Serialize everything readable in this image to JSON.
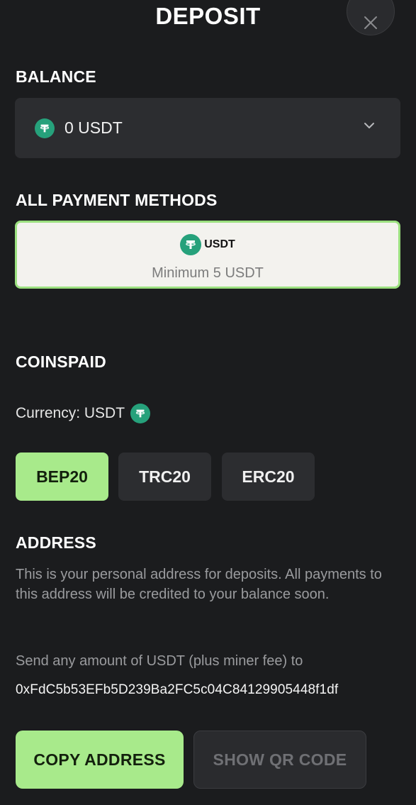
{
  "header": {
    "title": "DEPOSIT",
    "close_icon": "close-icon"
  },
  "balance": {
    "heading": "BALANCE",
    "selected_value": "0 USDT",
    "currency_icon": "tether-icon"
  },
  "payment_methods": {
    "heading": "ALL PAYMENT METHODS",
    "items": [
      {
        "name": "USDT",
        "minimum": "Minimum 5 USDT",
        "selected": true
      }
    ]
  },
  "provider": {
    "heading": "COINSPAID",
    "currency_label": "Currency: USDT",
    "networks": [
      {
        "label": "BEP20",
        "active": true
      },
      {
        "label": "TRC20",
        "active": false
      },
      {
        "label": "ERC20",
        "active": false
      }
    ]
  },
  "address_section": {
    "heading": "ADDRESS",
    "description": "This is your personal address for deposits. All payments to this address will be credited to your balance soon.",
    "send_instruction": "Send any amount of USDT (plus miner fee) to",
    "address": "0xFdC5b53EFb5D239Ba2FC5c04C84129905448f1df"
  },
  "actions": {
    "copy_label": "COPY ADDRESS",
    "qr_label": "SHOW QR CODE"
  },
  "colors": {
    "background": "#1b1c1e",
    "panel": "#2c2d30",
    "accent": "#a8ea8b",
    "tether": "#26a17b"
  }
}
